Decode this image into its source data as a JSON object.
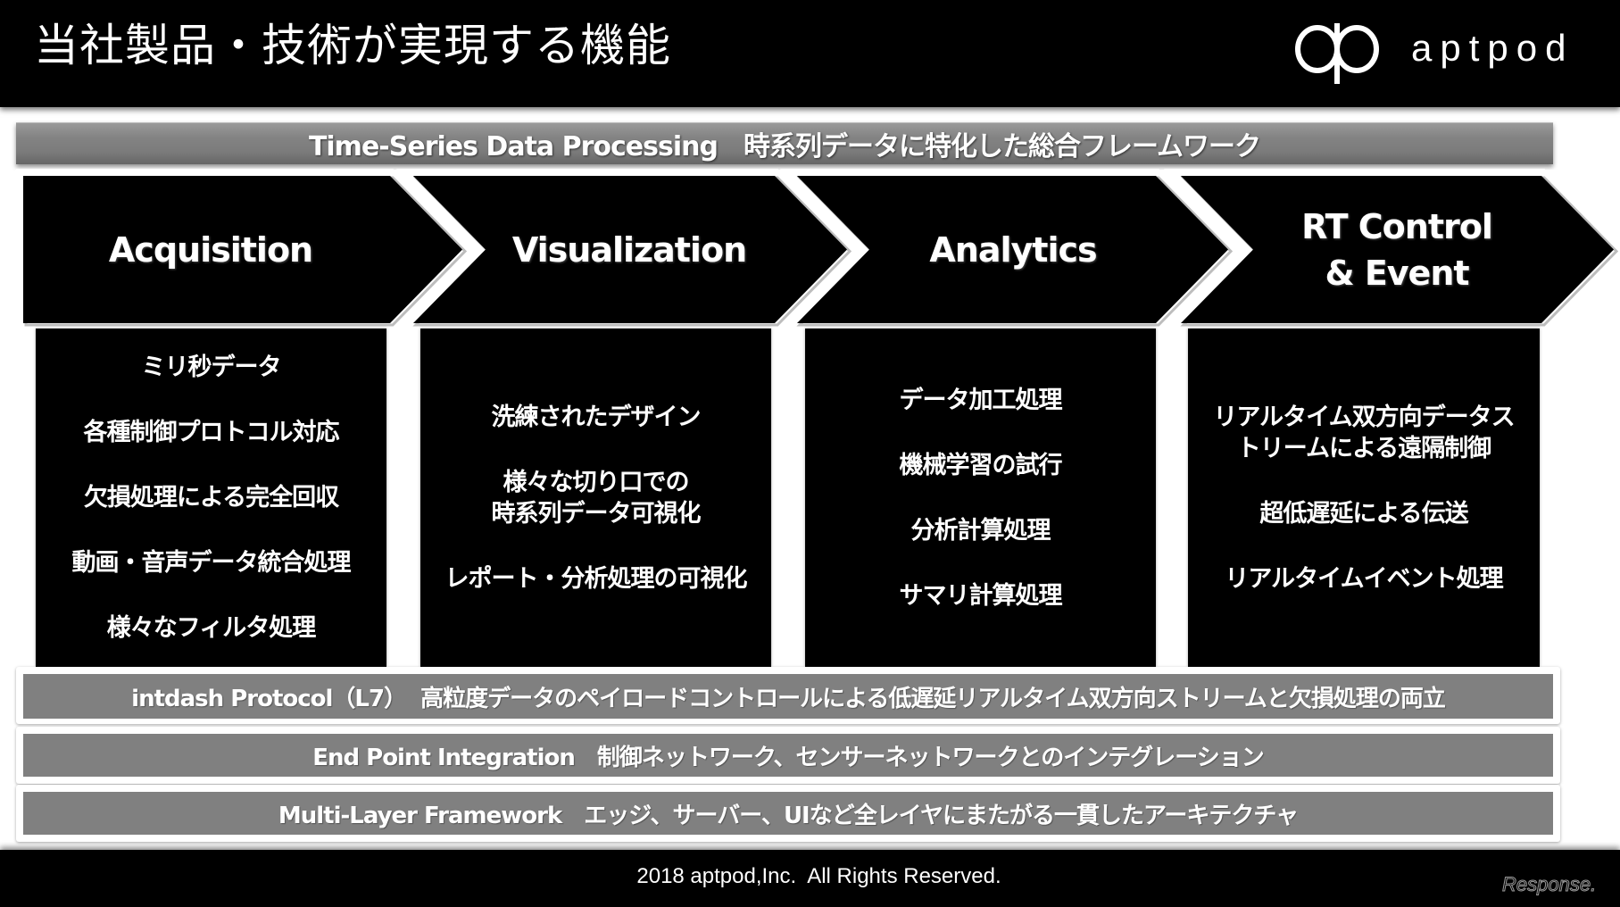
{
  "header": {
    "title": "当社製品・技術が実現する機能",
    "logo_text": "aptpod",
    "logo_icon": "aptpod-logo-icon"
  },
  "banner": {
    "label": "Time-Series Data Processing　時系列データに特化した総合フレームワーク"
  },
  "stages": [
    {
      "title": "Acquisition",
      "items": [
        "ミリ秒データ",
        "各種制御プロトコル対応",
        "欠損処理による完全回収",
        "動画・音声データ統合処理",
        "様々なフィルタ処理"
      ]
    },
    {
      "title": "Visualization",
      "items": [
        "洗練されたデザイン",
        "様々な切り口での\n時系列データ可視化",
        "レポート・分析処理の可視化"
      ]
    },
    {
      "title": "Analytics",
      "items": [
        "データ加工処理",
        "機械学習の試行",
        "分析計算処理",
        "サマリ計算処理"
      ]
    },
    {
      "title": "RT Control\n& Event",
      "title_lines": [
        "RT Control",
        "& Event"
      ],
      "items": [
        "リアルタイム双方向データス\nトリームによる遠隔制御",
        "超低遅延による伝送",
        "リアルタイムイベント処理"
      ]
    }
  ],
  "layers": [
    {
      "label": "intdash Protocol（L7）  高粒度データのペイロードコントロールによる低遅延リアルタイム双方向ストリームと欠損処理の両立"
    },
    {
      "label": "End Point Integration　制御ネットワーク、センサーネットワークとのインテグレーション"
    },
    {
      "label": "Multi-Layer Framework　エッジ、サーバー、UIなど全レイヤにまたがる一貫したアーキテクチャ"
    }
  ],
  "footer": {
    "copyright": "2018 aptpod,Inc.  All Rights Reserved.",
    "watermark": "Response."
  },
  "colors": {
    "background": "#000000",
    "panel": "#ffffff",
    "bar_gray": "#808080",
    "text": "#ffffff"
  }
}
